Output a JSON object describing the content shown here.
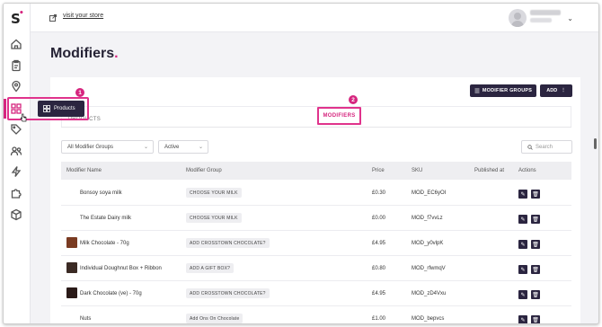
{
  "app": {
    "visit_store": "visit your store",
    "accent_color": "#d6267f",
    "dark_color": "#2b2540"
  },
  "sidebar": {
    "logo": "S",
    "items": [
      {
        "icon": "home-icon"
      },
      {
        "icon": "clipboard-icon"
      },
      {
        "icon": "location-icon"
      },
      {
        "icon": "products-grid-icon",
        "active": true
      },
      {
        "icon": "tag-icon"
      },
      {
        "icon": "users-icon"
      },
      {
        "icon": "lightning-icon"
      },
      {
        "icon": "puzzle-icon"
      },
      {
        "icon": "cube-icon"
      }
    ],
    "tooltip": "Products"
  },
  "page": {
    "title": "Modifiers"
  },
  "toolbar": {
    "modifier_groups_label": "MODIFIER GROUPS",
    "add_label": "ADD"
  },
  "tabs": [
    {
      "label": "PRODUCTS",
      "active": false
    },
    {
      "label": "MODIFIERS",
      "active": true
    }
  ],
  "annotations": {
    "step1": "1",
    "step2": "2"
  },
  "filters": {
    "group_select": "All Modifier Groups",
    "status_select": "Active",
    "search_placeholder": "Search"
  },
  "table": {
    "columns": [
      "Modifier Name",
      "Modifier Group",
      "Price",
      "SKU",
      "Published at",
      "Actions"
    ],
    "rows": [
      {
        "name": "Bonsoy soya milk",
        "group": "CHOOSE YOUR MILK",
        "price": "£0.30",
        "sku": "MOD_EC6yOI",
        "thumb": false
      },
      {
        "name": "The Estate Dairy milk",
        "group": "CHOOSE YOUR MILK",
        "price": "£0.00",
        "sku": "MOD_f7vvLz",
        "thumb": false
      },
      {
        "name": "Milk Chocolate - 70g",
        "group": "ADD CROSSTOWN CHOCOLATE?",
        "price": "£4.95",
        "sku": "MOD_y0vlpK",
        "thumb": true,
        "thumb_color": "#7a3b22"
      },
      {
        "name": "Individual Doughnut Box + Ribbon",
        "group": "ADD A GIFT BOX?",
        "price": "£0.80",
        "sku": "MOD_rfwmqV",
        "thumb": true,
        "thumb_color": "#3b2a24"
      },
      {
        "name": "Dark Chocolate (ve) - 70g",
        "group": "ADD CROSSTOWN CHOCOLATE?",
        "price": "£4.95",
        "sku": "MOD_zD4Vxu",
        "thumb": true,
        "thumb_color": "#2a1a18"
      },
      {
        "name": "Nuts",
        "group": "Add Ons On Chocolate",
        "price": "£1.00",
        "sku": "MOD_bepvcs",
        "thumb": false
      }
    ]
  }
}
